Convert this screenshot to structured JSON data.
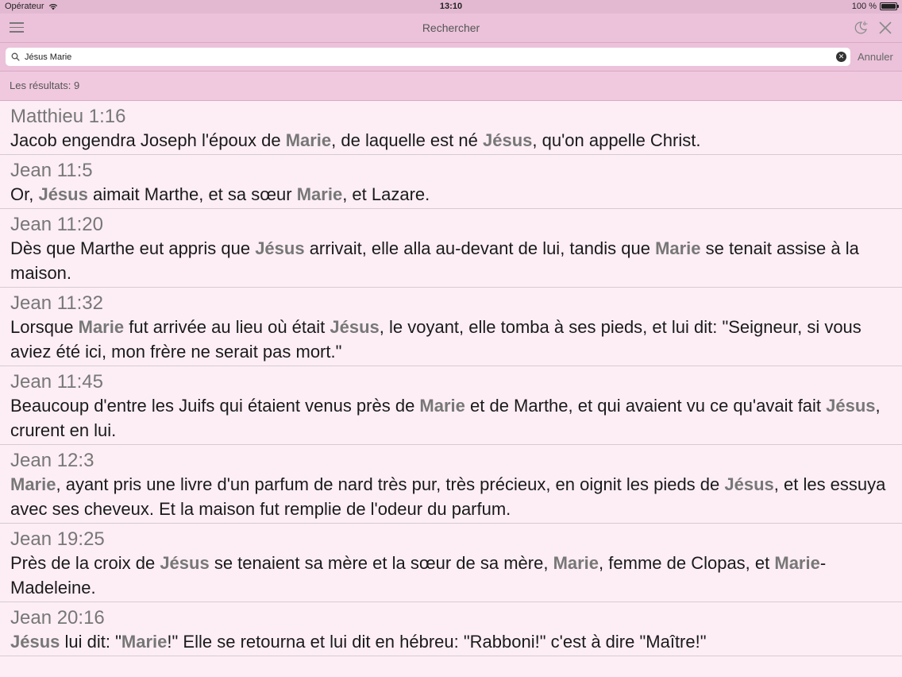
{
  "status_bar": {
    "carrier": "Opérateur",
    "time": "13:10",
    "battery": "100 %"
  },
  "nav": {
    "title": "Rechercher",
    "menu_icon": "hamburger-menu-icon",
    "night_icon": "moon-sun-icon",
    "close_icon": "close-x-icon"
  },
  "search": {
    "value": "Jésus Marie",
    "cancel_label": "Annuler"
  },
  "results_header": {
    "label": "Les résultats: ",
    "count": "9"
  },
  "colors": {
    "nav_bg": "#ebc2da",
    "list_bg": "#fdeef5",
    "highlight": "#777777"
  },
  "results": [
    {
      "ref": "Matthieu 1:16",
      "segments": [
        {
          "t": "Jacob engendra Joseph l'époux de "
        },
        {
          "t": "Marie",
          "hl": true
        },
        {
          "t": ", de laquelle est né "
        },
        {
          "t": "Jésus",
          "hl": true
        },
        {
          "t": ", qu'on appelle Christ."
        }
      ]
    },
    {
      "ref": "Jean 11:5",
      "segments": [
        {
          "t": "Or, "
        },
        {
          "t": "Jésus",
          "hl": true
        },
        {
          "t": " aimait Marthe, et sa sœur "
        },
        {
          "t": "Marie",
          "hl": true
        },
        {
          "t": ", et Lazare."
        }
      ]
    },
    {
      "ref": "Jean 11:20",
      "segments": [
        {
          "t": "Dès que Marthe eut appris que "
        },
        {
          "t": "Jésus",
          "hl": true
        },
        {
          "t": " arrivait, elle alla au-devant de lui, tandis que "
        },
        {
          "t": "Marie",
          "hl": true
        },
        {
          "t": " se tenait assise à la maison."
        }
      ]
    },
    {
      "ref": "Jean 11:32",
      "segments": [
        {
          "t": "Lorsque "
        },
        {
          "t": "Marie",
          "hl": true
        },
        {
          "t": " fut arrivée au lieu où était "
        },
        {
          "t": "Jésus",
          "hl": true
        },
        {
          "t": ", le voyant, elle tomba à ses pieds, et lui dit: \"Seigneur, si vous aviez été ici, mon frère ne serait pas mort.\""
        }
      ]
    },
    {
      "ref": "Jean 11:45",
      "segments": [
        {
          "t": "Beaucoup d'entre les Juifs qui étaient venus près de "
        },
        {
          "t": "Marie",
          "hl": true
        },
        {
          "t": " et de Marthe, et qui avaient vu ce qu'avait fait "
        },
        {
          "t": "Jésus",
          "hl": true
        },
        {
          "t": ", crurent en lui."
        }
      ]
    },
    {
      "ref": "Jean 12:3",
      "segments": [
        {
          "t": "Marie",
          "hl": true
        },
        {
          "t": ", ayant pris une livre d'un parfum de nard très pur, très précieux, en oignit les pieds de "
        },
        {
          "t": "Jésus",
          "hl": true
        },
        {
          "t": ", et les essuya avec ses cheveux. Et la maison fut remplie de l'odeur du parfum."
        }
      ]
    },
    {
      "ref": "Jean 19:25",
      "segments": [
        {
          "t": "Près de la croix de "
        },
        {
          "t": "Jésus",
          "hl": true
        },
        {
          "t": " se tenaient sa mère et la sœur de sa mère, "
        },
        {
          "t": "Marie",
          "hl": true
        },
        {
          "t": ", femme de Clopas, et "
        },
        {
          "t": "Marie",
          "hl": true
        },
        {
          "t": "-Madeleine."
        }
      ]
    },
    {
      "ref": "Jean 20:16",
      "segments": [
        {
          "t": "Jésus",
          "hl": true
        },
        {
          "t": " lui dit: \""
        },
        {
          "t": "Marie",
          "hl": true
        },
        {
          "t": "!\" Elle se retourna et lui dit en hébreu: \"Rabboni!\" c'est à dire \"Maître!\""
        }
      ]
    }
  ]
}
